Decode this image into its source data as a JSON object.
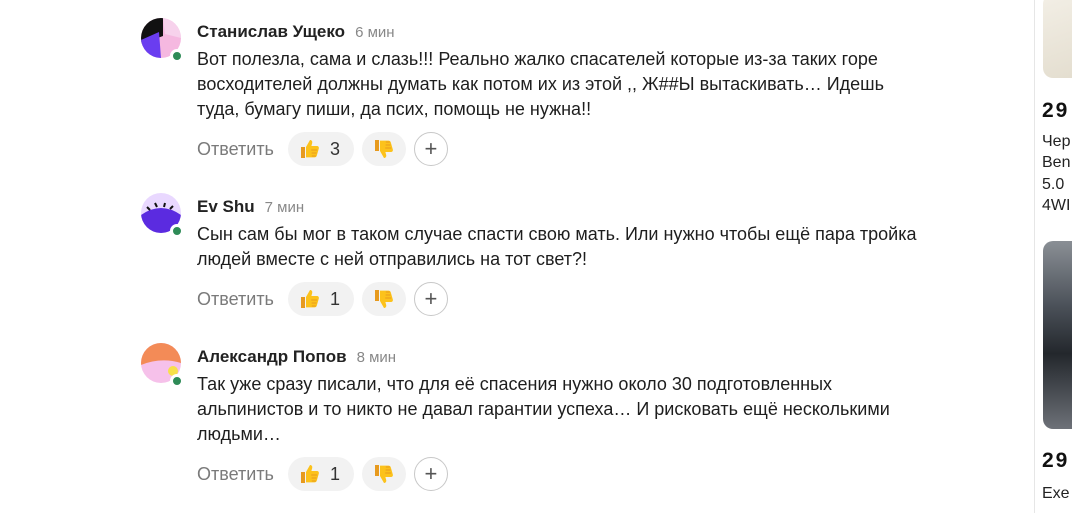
{
  "comments": [
    {
      "author": "Станислав Ущеко",
      "time": "6 мин",
      "text_lines": [
        "Вот полезла, сама и слазь!!! Реально жалко спасателей которые из-за таких горе",
        "восходителей должны думать как потом их из этой ,, Ж##Ы вытаскивать… Идешь",
        "туда, бумагу пиши, да псих, помощь не нужна!!"
      ],
      "reply_label": "Ответить",
      "likes": "3",
      "add_label": "+"
    },
    {
      "author": "Ev Shu",
      "time": "7 мин",
      "text_lines": [
        "Сын сам бы мог в таком случае спасти свою мать. Или нужно чтобы ещё пара тройка",
        "людей вместе с ней отправились на тот свет?!"
      ],
      "reply_label": "Ответить",
      "likes": "1",
      "add_label": "+"
    },
    {
      "author": "Александр Попов",
      "time": "8 мин",
      "text_lines": [
        "Так уже сразу писали, что для её спасения нужно около 30 подготовленных",
        "альпинистов и то никто не давал гарантии успеха… И рисковать ещё несколькими",
        "людьми…"
      ],
      "reply_label": "Ответить",
      "likes": "1",
      "add_label": "+"
    }
  ],
  "sidebar": {
    "ad1_price": "29",
    "ad1_lines": [
      "Чер",
      "Ben",
      "5.0",
      "4WI"
    ],
    "ad2_price": "29",
    "ad2_lines": [
      "Exe"
    ]
  },
  "icons": {
    "like": "thumbs-up-emoji",
    "dislike": "thumbs-down-emoji",
    "add": "plus-icon"
  },
  "colors": {
    "online": "#2e8b57",
    "pill_bg": "#f2f2f2",
    "muted_text": "#7a7a7a"
  }
}
